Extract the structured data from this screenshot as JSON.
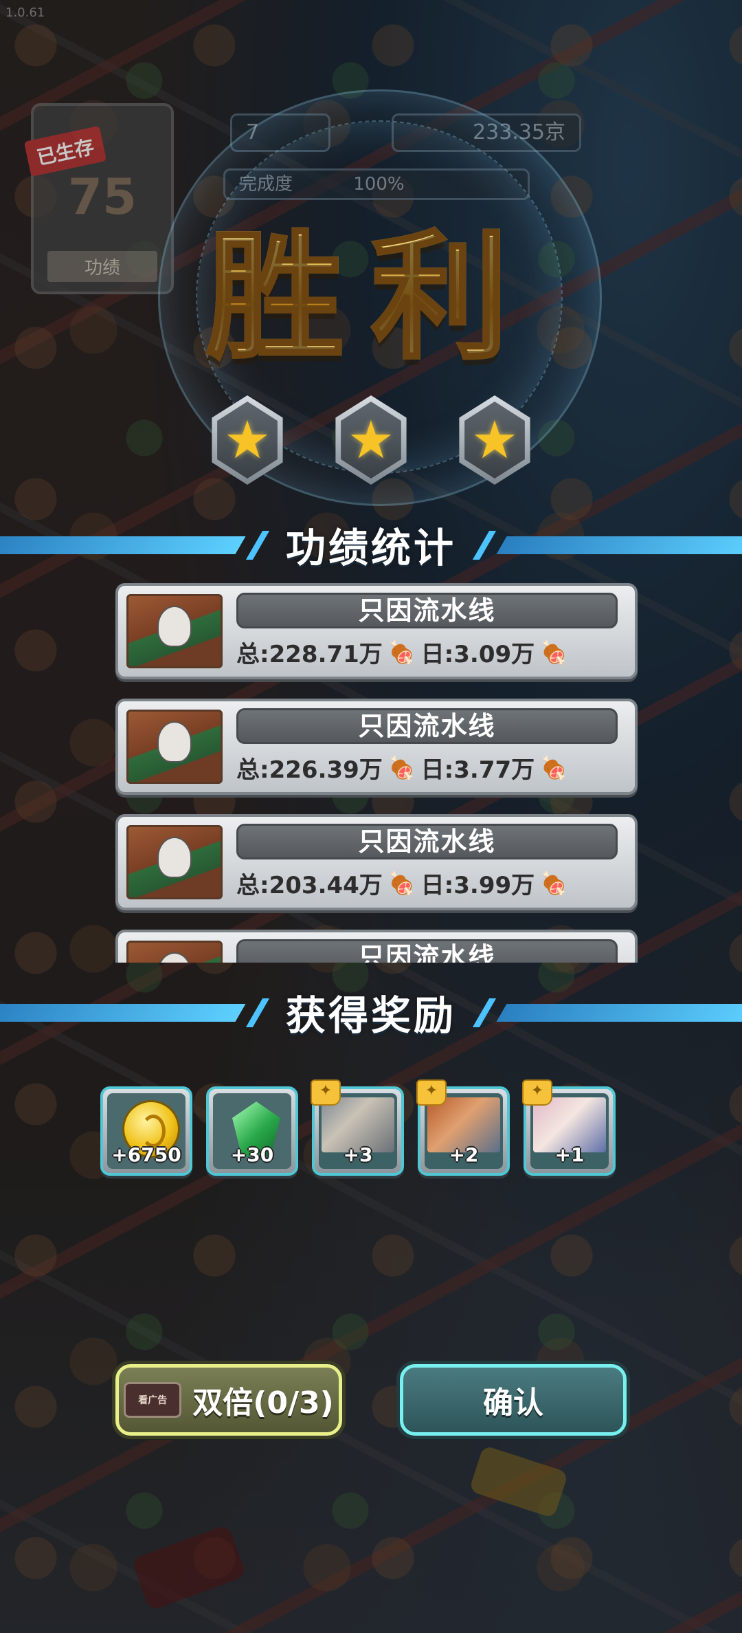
{
  "version": "1.0.61",
  "hud": {
    "survive_badge": "已生存",
    "survive_days": "75",
    "survive_label": "功绩",
    "level": "7",
    "currency": "233.35京",
    "progress_label": "完成度",
    "progress_value": "100%",
    "progress_fraction": 1.0
  },
  "victory_title": "胜利",
  "stars": {
    "earned": 3,
    "total": 3,
    "icon": "star-icon"
  },
  "stats_section": {
    "title": "功绩统计",
    "items": [
      {
        "name": "只因流水线",
        "total": "总:228.71万",
        "daily": "日:3.09万",
        "icon": "meat-icon"
      },
      {
        "name": "只因流水线",
        "total": "总:226.39万",
        "daily": "日:3.77万",
        "icon": "meat-icon"
      },
      {
        "name": "只因流水线",
        "total": "总:203.44万",
        "daily": "日:3.99万",
        "icon": "meat-icon"
      },
      {
        "name": "只因流水线",
        "total": "",
        "daily": "",
        "icon": "meat-icon"
      }
    ]
  },
  "rewards_section": {
    "title": "获得奖励",
    "items": [
      {
        "type": "coin",
        "amount": "+6750",
        "icon": "coin-icon"
      },
      {
        "type": "gem",
        "amount": "+30",
        "icon": "gem-icon"
      },
      {
        "type": "card",
        "amount": "+3",
        "icon": "puzzle-icon"
      },
      {
        "type": "card",
        "amount": "+2",
        "icon": "puzzle-icon"
      },
      {
        "type": "card",
        "amount": "+1",
        "icon": "puzzle-icon"
      }
    ]
  },
  "buttons": {
    "double_label": "双倍(0/3)",
    "ad_tag": "看广告",
    "confirm_label": "确认"
  },
  "colors": {
    "accent_blue": "#4cc3ff",
    "gold": "#f6d36a",
    "confirm_border": "#79f0f0",
    "double_border": "#e9f08a"
  }
}
